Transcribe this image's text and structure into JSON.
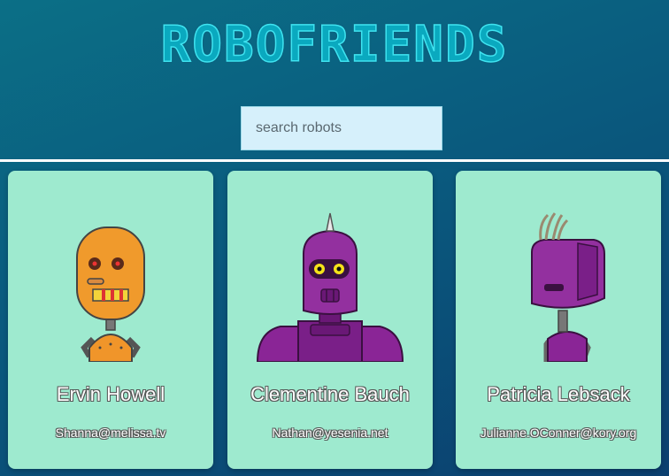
{
  "app": {
    "title": "ROBOFRIENDS",
    "search": {
      "placeholder": "search robots",
      "value": ""
    }
  },
  "colors": {
    "background_start": "#0b6f86",
    "background_end": "#0b3f6f",
    "card": "#9eeacf",
    "title": "#0aa9bf",
    "search_box": "#d6f0fb"
  },
  "robots": [
    {
      "name": "Ervin Howell",
      "email": "Shanna@melissa.tv",
      "avatar": "orange-robot-avatar"
    },
    {
      "name": "Clementine Bauch",
      "email": "Nathan@yesenia.net",
      "avatar": "purple-robot-avatar"
    },
    {
      "name": "Patricia Lebsack",
      "email": "Julianne.OConner@kory.org",
      "avatar": "purple-robot-avatar"
    }
  ]
}
